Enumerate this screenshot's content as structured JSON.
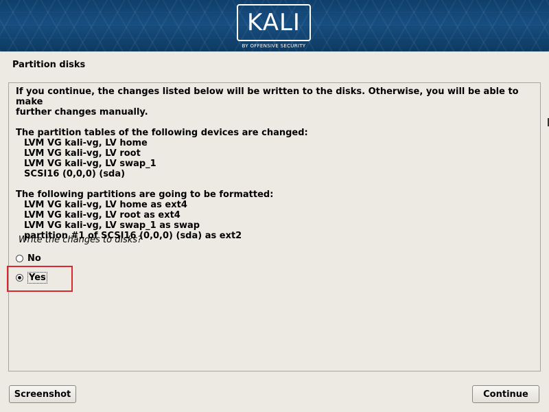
{
  "banner": {
    "logo_text": "KALI",
    "logo_sub": "BY OFFENSIVE SECURITY",
    "bg_color": "#174e80"
  },
  "page_title": "Partition disks",
  "content": {
    "intro": [
      "If you continue, the changes listed below will be written to the disks. Otherwise, you will be able to make",
      "further changes manually."
    ],
    "partition_tables_heading": "The partition tables of the following devices are changed:",
    "partition_tables": [
      "LVM VG kali-vg, LV home",
      "LVM VG kali-vg, LV root",
      "LVM VG kali-vg, LV swap_1",
      "SCSI16 (0,0,0) (sda)"
    ],
    "formatted_heading": "The following partitions are going to be formatted:",
    "formatted": [
      "LVM VG kali-vg, LV home as ext4",
      "LVM VG kali-vg, LV root as ext4",
      "LVM VG kali-vg, LV swap_1 as swap",
      "partition #1 of SCSI16 (0,0,0) (sda) as ext2"
    ],
    "question": "Write the changes to disks?",
    "options": [
      {
        "label": "No",
        "selected": false
      },
      {
        "label": "Yes",
        "selected": true
      }
    ],
    "highlight_color": "#d9262f"
  },
  "buttons": {
    "screenshot": "Screenshot",
    "continue": "Continue"
  }
}
